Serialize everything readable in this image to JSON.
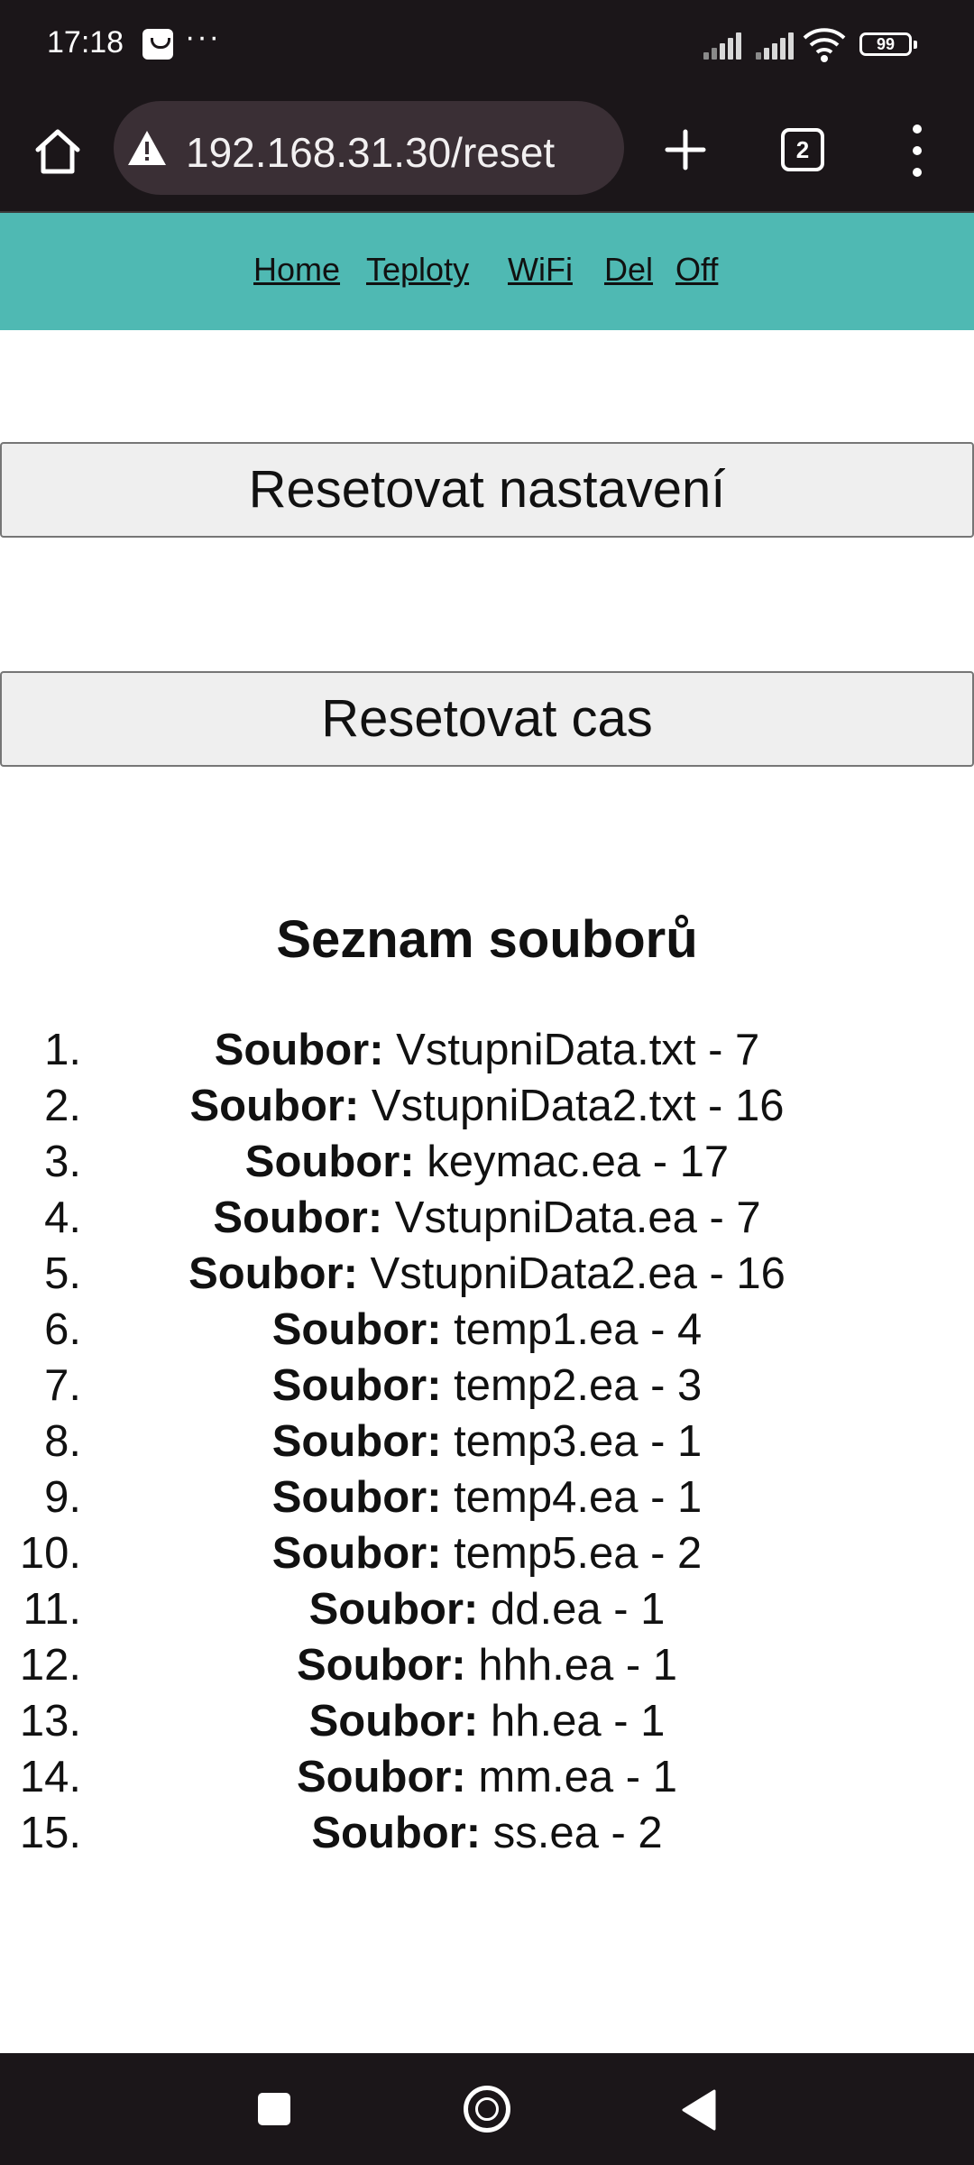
{
  "status_bar": {
    "time": "17:18",
    "more": "···",
    "battery": "99",
    "icons": [
      "notification-icon",
      "signal-icon",
      "signal-icon",
      "wifi-icon",
      "battery-icon"
    ]
  },
  "browser": {
    "url": "192.168.31.30/reset",
    "tab_count": "2",
    "icons": [
      "home-icon",
      "warning-icon",
      "plus-icon",
      "tabs-icon",
      "menu-icon"
    ]
  },
  "nav": {
    "home": "Home",
    "teploty": "Teploty",
    "wifi": "WiFi",
    "del": "Del",
    "off": "Off",
    "color": "#4fb9b3"
  },
  "buttons": {
    "reset_settings": "Resetovat nastavení",
    "reset_time": "Resetovat cas"
  },
  "files": {
    "heading": "Seznam souborů",
    "label": "Soubor:",
    "items": [
      {
        "num": "1.",
        "name": "VstupniData.txt - 7"
      },
      {
        "num": "2.",
        "name": "VstupniData2.txt - 16"
      },
      {
        "num": "3.",
        "name": "keymac.ea - 17"
      },
      {
        "num": "4.",
        "name": "VstupniData.ea - 7"
      },
      {
        "num": "5.",
        "name": "VstupniData2.ea - 16"
      },
      {
        "num": "6.",
        "name": "temp1.ea - 4"
      },
      {
        "num": "7.",
        "name": "temp2.ea - 3"
      },
      {
        "num": "8.",
        "name": "temp3.ea - 1"
      },
      {
        "num": "9.",
        "name": "temp4.ea - 1"
      },
      {
        "num": "10.",
        "name": "temp5.ea - 2"
      },
      {
        "num": "11.",
        "name": "dd.ea - 1"
      },
      {
        "num": "12.",
        "name": "hhh.ea - 1"
      },
      {
        "num": "13.",
        "name": "hh.ea - 1"
      },
      {
        "num": "14.",
        "name": "mm.ea - 1"
      },
      {
        "num": "15.",
        "name": "ss.ea - 2"
      }
    ]
  },
  "system_nav": {
    "icons": [
      "recents-icon",
      "home-circle-icon",
      "back-icon"
    ]
  }
}
